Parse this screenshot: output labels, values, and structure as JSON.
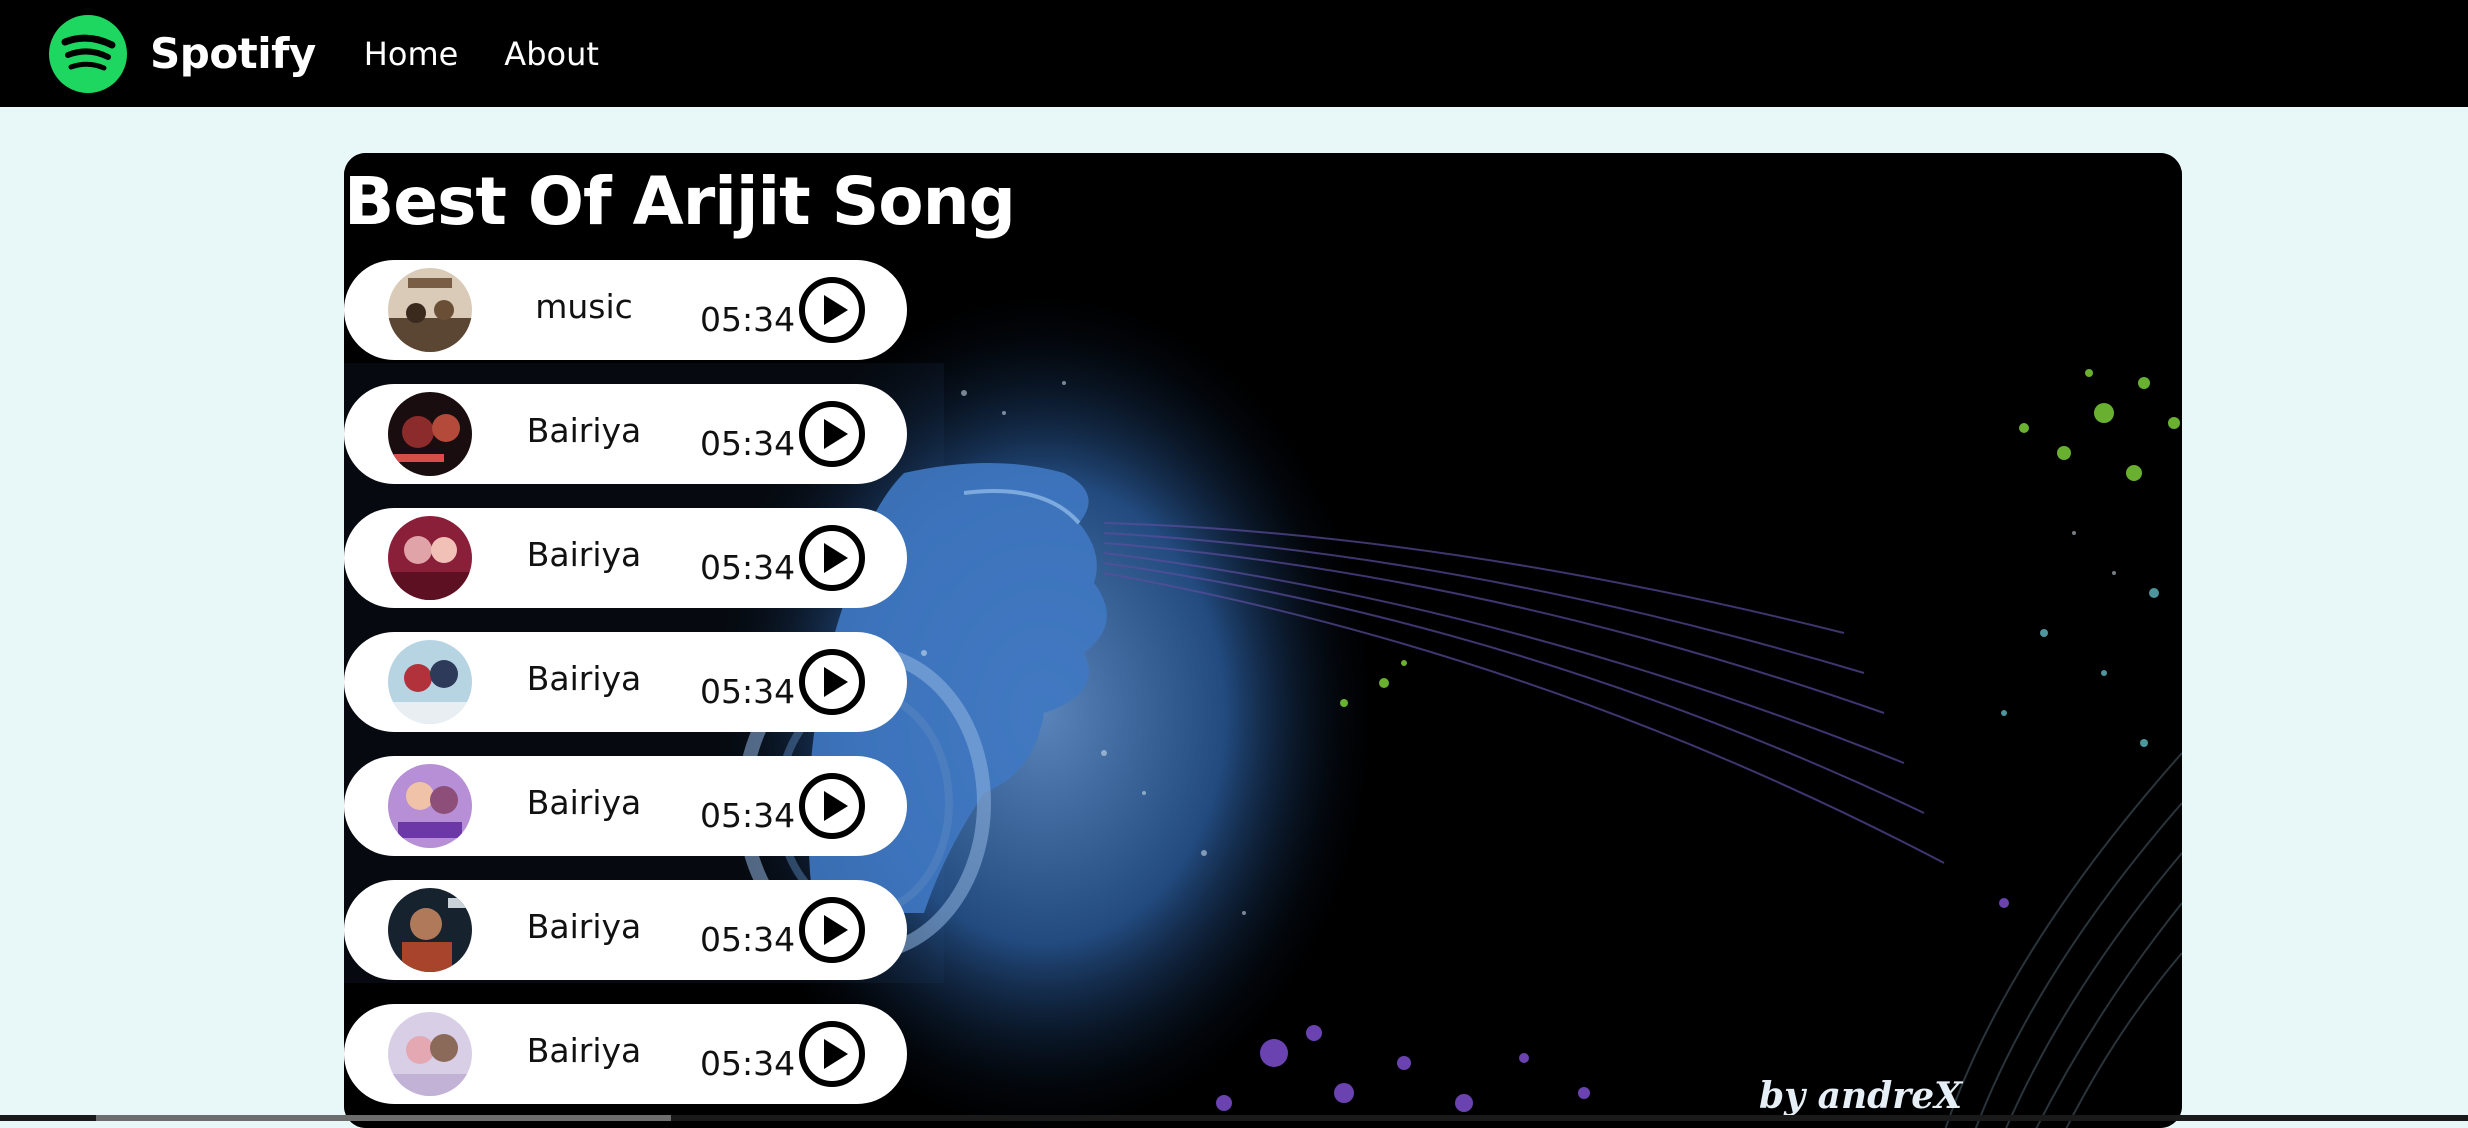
{
  "brand": {
    "name": "Spotify",
    "color": "#1ed760"
  },
  "nav": {
    "links": [
      "Home",
      "About"
    ]
  },
  "playlist": {
    "title": "Best Of Arijit Song",
    "background_signature": "by andreX",
    "songs": [
      {
        "name": "music",
        "duration": "05:34",
        "cover_icon": "album-cover-1",
        "play_icon": "play-circle-icon"
      },
      {
        "name": "Bairiya",
        "duration": "05:34",
        "cover_icon": "album-cover-2",
        "play_icon": "play-circle-icon"
      },
      {
        "name": "Bairiya",
        "duration": "05:34",
        "cover_icon": "album-cover-3",
        "play_icon": "play-circle-icon"
      },
      {
        "name": "Bairiya",
        "duration": "05:34",
        "cover_icon": "album-cover-4",
        "play_icon": "play-circle-icon"
      },
      {
        "name": "Bairiya",
        "duration": "05:34",
        "cover_icon": "album-cover-5",
        "play_icon": "play-circle-icon"
      },
      {
        "name": "Bairiya",
        "duration": "05:34",
        "cover_icon": "album-cover-6",
        "play_icon": "play-circle-icon"
      },
      {
        "name": "Bairiya",
        "duration": "05:34",
        "cover_icon": "album-cover-7",
        "play_icon": "play-circle-icon"
      }
    ]
  },
  "colors": {
    "nav_bg": "#000000",
    "page_bg": "#e8f8f8",
    "item_bg": "#ffffff",
    "accent": "#1ed760"
  }
}
